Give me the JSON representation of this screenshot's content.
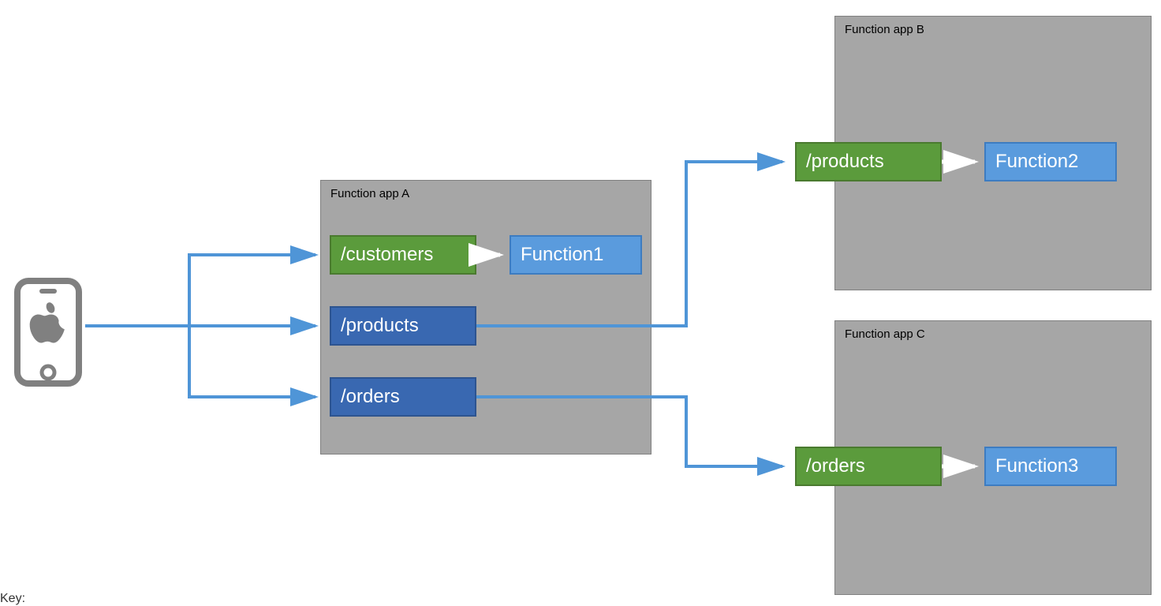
{
  "containers": {
    "a": {
      "label": "Function app A"
    },
    "b": {
      "label": "Function app B"
    },
    "c": {
      "label": "Function app C"
    }
  },
  "appA": {
    "customers": {
      "label": "/customers"
    },
    "products": {
      "label": "/products"
    },
    "orders": {
      "label": "/orders"
    },
    "function1": {
      "label": "Function1"
    }
  },
  "appB": {
    "products": {
      "label": "/products"
    },
    "function2": {
      "label": "Function2"
    }
  },
  "appC": {
    "orders": {
      "label": "/orders"
    },
    "function3": {
      "label": "Function3"
    }
  },
  "keyLabel": "Key:",
  "colors": {
    "arrowBlue": "#4f95d7",
    "arrowWhite": "#ffffff",
    "containerFill": "#a6a6a6",
    "green": "#5b9b3c",
    "darkblue": "#3968b1",
    "lightblue": "#5a9bdd",
    "deviceGray": "#808080"
  }
}
